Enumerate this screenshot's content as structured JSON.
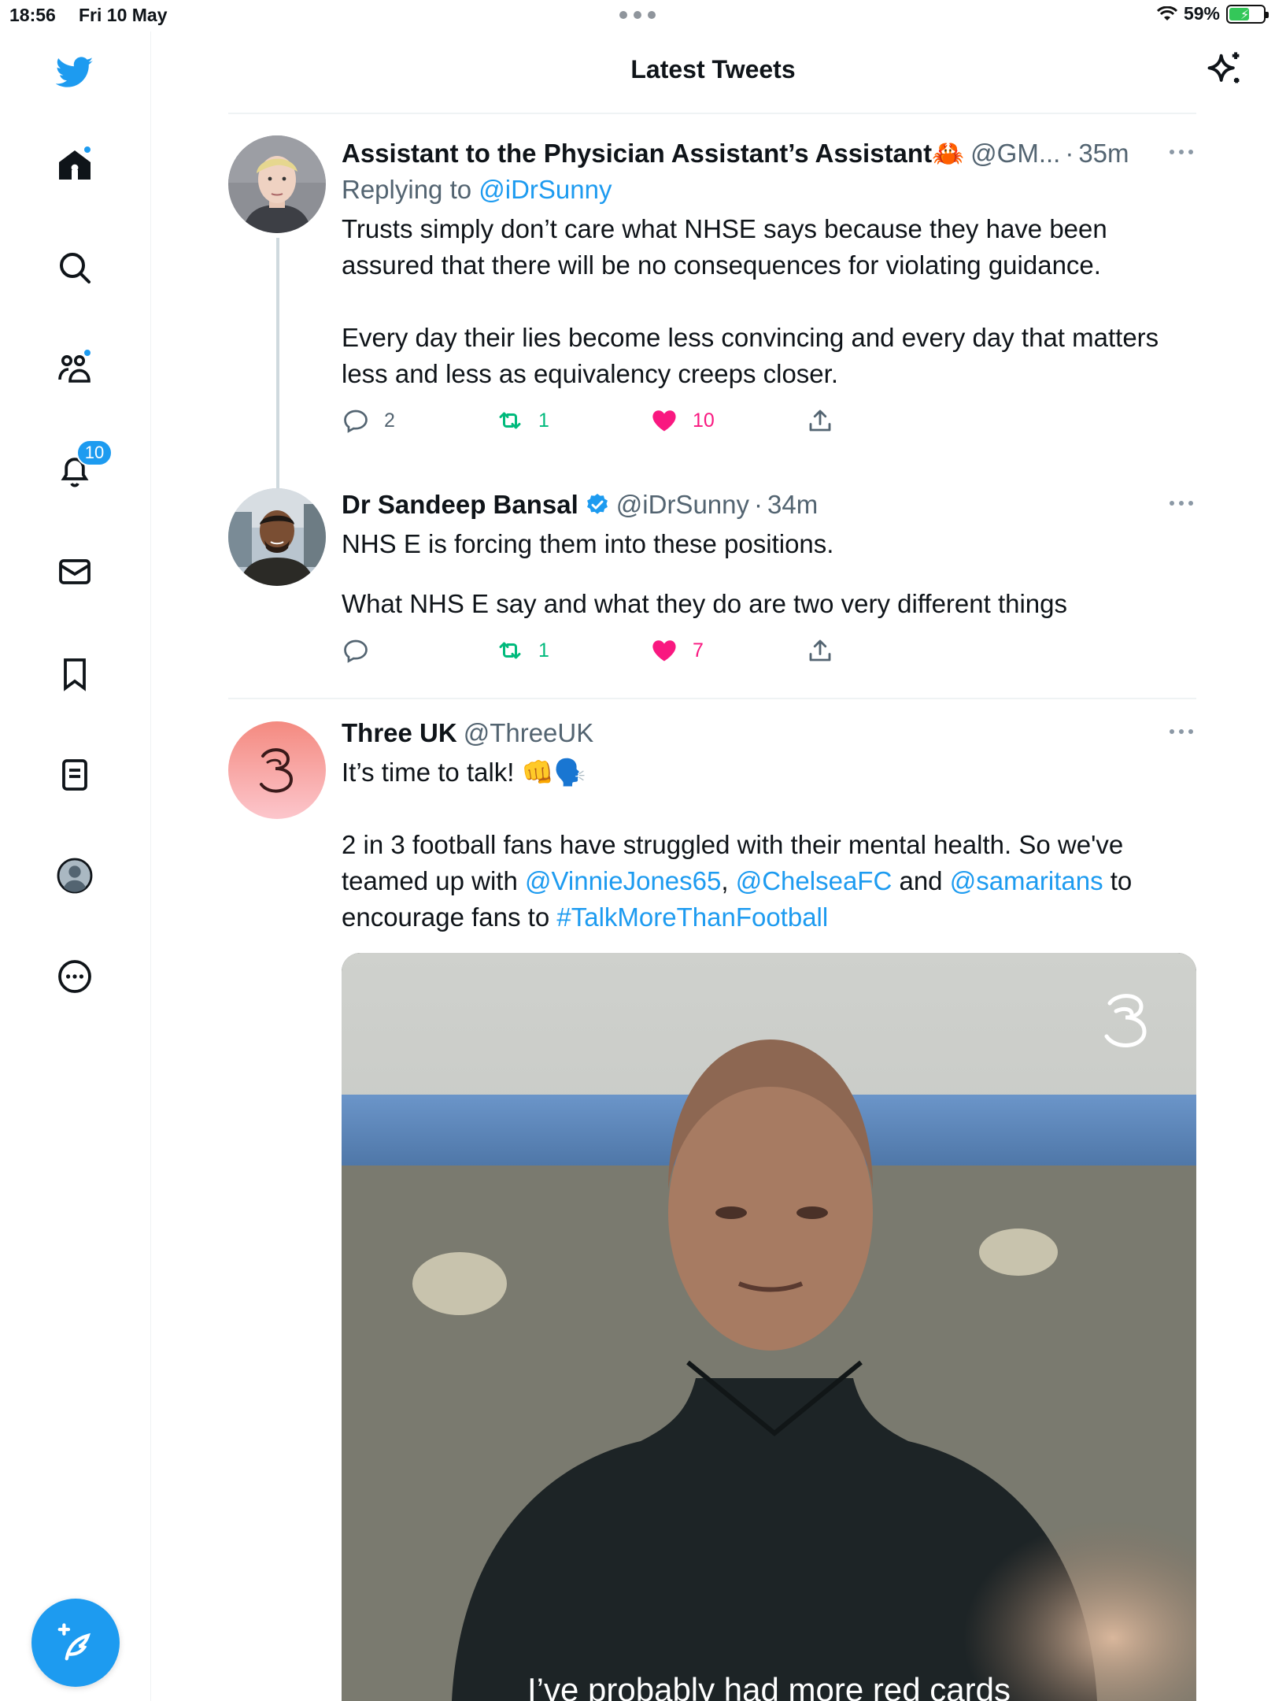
{
  "status_bar": {
    "time": "18:56",
    "date": "Fri 10 May",
    "battery_percent": "59%",
    "battery_level": 0.59
  },
  "sidebar": {
    "notifications_badge": "10",
    "items": [
      {
        "name": "home",
        "icon": "home-icon",
        "has_dot": true
      },
      {
        "name": "explore",
        "icon": "search-icon"
      },
      {
        "name": "communities",
        "icon": "communities-icon",
        "has_dot": true
      },
      {
        "name": "notifications",
        "icon": "bell-icon"
      },
      {
        "name": "messages",
        "icon": "mail-icon"
      },
      {
        "name": "bookmarks",
        "icon": "bookmark-icon"
      },
      {
        "name": "lists",
        "icon": "list-icon"
      },
      {
        "name": "profile",
        "icon": "profile-icon"
      },
      {
        "name": "more",
        "icon": "more-circle-icon"
      }
    ]
  },
  "header": {
    "title": "Latest Tweets"
  },
  "tweets": [
    {
      "author": "Assistant to the Physician Assistant’s Assistant🦀",
      "handle": "@GM...",
      "time": "35m",
      "reply_prefix": "Replying to ",
      "reply_handle": "@iDrSunny",
      "text_1": "Trusts simply don’t care what NHSE says because they have been assured that there will be no consequences for violating guidance.",
      "text_2": "Every day their lies become less convincing and every day that matters less and less as equivalency creeps closer.",
      "replies": "2",
      "retweets": "1",
      "likes": "10"
    },
    {
      "author": "Dr Sandeep Bansal",
      "handle": "@iDrSunny",
      "time": "34m",
      "verified": true,
      "text_1": "NHS E is forcing them into these positions.",
      "text_2": "What NHS E say and what they do are two very different things",
      "replies": "",
      "retweets": "1",
      "likes": "7"
    },
    {
      "author": "Three UK",
      "handle": "@ThreeUK",
      "text_1": "It’s time to talk! 👊🗣️",
      "text_2a": "2 in 3 football fans have struggled with their mental health. So we've teamed up with ",
      "mention_1": "@VinnieJones65",
      "comma": ", ",
      "mention_2": "@ChelseaFC",
      "and": " and ",
      "mention_3": "@samaritans",
      "to": " to encourage fans to ",
      "hashtag": "#TalkMoreThanFootball",
      "video_caption": "I’ve probably had more red cards"
    }
  ],
  "colors": {
    "accent": "#1d9bf0",
    "retweet": "#00ba7c",
    "like": "#f91880",
    "secondary_text": "#536471"
  }
}
